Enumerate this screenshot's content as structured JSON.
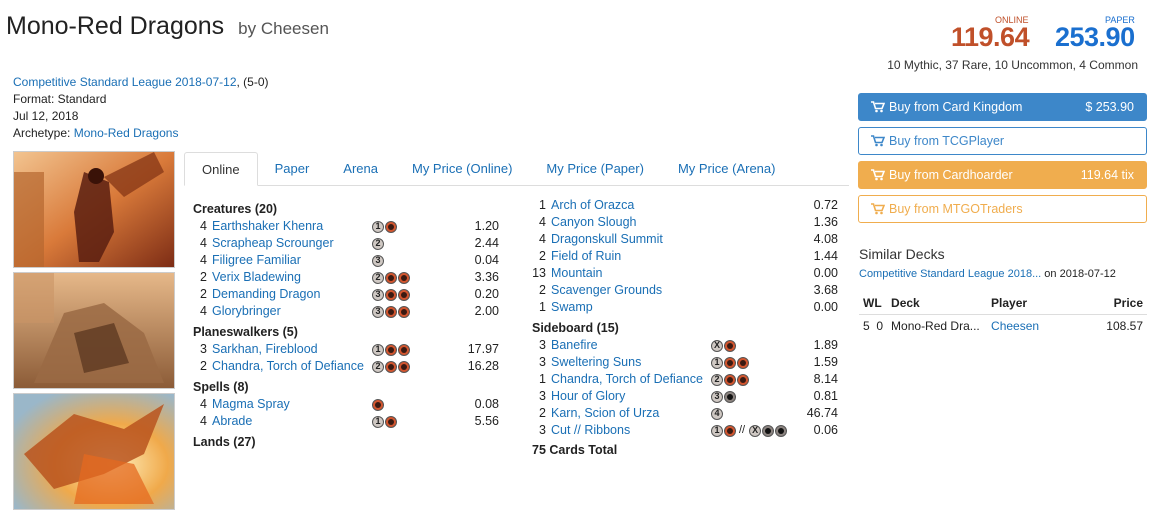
{
  "deck": {
    "title": "Mono-Red Dragons",
    "author": "by Cheesen",
    "event_link": "Competitive Standard League 2018-07-12",
    "record": ", (5-0)",
    "format": "Format: Standard",
    "date": "Jul 12, 2018",
    "archetype_label": "Archetype:",
    "archetype": "Mono-Red Dragons"
  },
  "prices": {
    "online_label": "ONLINE",
    "online_value": "119.64",
    "paper_label": "PAPER",
    "paper_value": "253.90",
    "rarity": "10 Mythic, 37 Rare, 10 Uncommon, 4 Common",
    "online_color": "#c0502a",
    "paper_color": "#1a6fcf"
  },
  "buy": [
    {
      "label": "Buy from Card Kingdom",
      "amount": "$ 253.90",
      "style": "solid",
      "color": "#3d87c9"
    },
    {
      "label": "Buy from TCGPlayer",
      "amount": "",
      "style": "outline",
      "color": "#3d87c9"
    },
    {
      "label": "Buy from Cardhoarder",
      "amount": "119.64 tix",
      "style": "solid",
      "color": "#f0ad4e"
    },
    {
      "label": "Buy from MTGOTraders",
      "amount": "",
      "style": "outline",
      "color": "#f0ad4e"
    }
  ],
  "similar": {
    "heading": "Similar Decks",
    "link": "Competitive Standard League 2018...",
    "link_suffix": " on 2018-07-12",
    "headers": [
      "WL",
      "Deck",
      "Player",
      "Price"
    ],
    "rows": [
      {
        "w": "5",
        "l": "0",
        "deck": "Mono-Red Dra...",
        "player": "Cheesen",
        "price": "108.57"
      }
    ]
  },
  "tabs": [
    "Online",
    "Paper",
    "Arena",
    "My Price (Online)",
    "My Price (Paper)",
    "My Price (Arena)"
  ],
  "left_column": [
    {
      "section": "Creatures (20)",
      "cards": [
        {
          "qty": "4",
          "name": "Earthshaker Khenra",
          "cost": [
            "1",
            "R"
          ],
          "price": "1.20"
        },
        {
          "qty": "4",
          "name": "Scrapheap Scrounger",
          "cost": [
            "2"
          ],
          "price": "2.44"
        },
        {
          "qty": "4",
          "name": "Filigree Familiar",
          "cost": [
            "3"
          ],
          "price": "0.04"
        },
        {
          "qty": "2",
          "name": "Verix Bladewing",
          "cost": [
            "2",
            "R",
            "R"
          ],
          "price": "3.36"
        },
        {
          "qty": "2",
          "name": "Demanding Dragon",
          "cost": [
            "3",
            "R",
            "R"
          ],
          "price": "0.20"
        },
        {
          "qty": "4",
          "name": "Glorybringer",
          "cost": [
            "3",
            "R",
            "R"
          ],
          "price": "2.00"
        }
      ]
    },
    {
      "section": "Planeswalkers (5)",
      "cards": [
        {
          "qty": "3",
          "name": "Sarkhan, Fireblood",
          "cost": [
            "1",
            "R",
            "R"
          ],
          "price": "17.97"
        },
        {
          "qty": "2",
          "name": "Chandra, Torch of Defiance",
          "cost": [
            "2",
            "R",
            "R"
          ],
          "price": "16.28"
        }
      ]
    },
    {
      "section": "Spells (8)",
      "cards": [
        {
          "qty": "4",
          "name": "Magma Spray",
          "cost": [
            "R"
          ],
          "price": "0.08"
        },
        {
          "qty": "4",
          "name": "Abrade",
          "cost": [
            "1",
            "R"
          ],
          "price": "5.56"
        }
      ]
    },
    {
      "section": "Lands (27)",
      "cards": []
    }
  ],
  "lands": [
    {
      "qty": "1",
      "name": "Arch of Orazca",
      "price": "0.72"
    },
    {
      "qty": "4",
      "name": "Canyon Slough",
      "price": "1.36"
    },
    {
      "qty": "4",
      "name": "Dragonskull Summit",
      "price": "4.08"
    },
    {
      "qty": "2",
      "name": "Field of Ruin",
      "price": "1.44"
    },
    {
      "qty": "13",
      "name": "Mountain",
      "price": "0.00"
    },
    {
      "qty": "2",
      "name": "Scavenger Grounds",
      "price": "3.68"
    },
    {
      "qty": "1",
      "name": "Swamp",
      "price": "0.00"
    }
  ],
  "sideboard": {
    "section": "Sideboard (15)",
    "cards": [
      {
        "qty": "3",
        "name": "Banefire",
        "cost": [
          "X",
          "R"
        ],
        "price": "1.89"
      },
      {
        "qty": "3",
        "name": "Sweltering Suns",
        "cost": [
          "1",
          "R",
          "R"
        ],
        "price": "1.59"
      },
      {
        "qty": "1",
        "name": "Chandra, Torch of Defiance",
        "cost": [
          "2",
          "R",
          "R"
        ],
        "price": "8.14"
      },
      {
        "qty": "3",
        "name": "Hour of Glory",
        "cost": [
          "3",
          "B"
        ],
        "price": "0.81"
      },
      {
        "qty": "2",
        "name": "Karn, Scion of Urza",
        "cost": [
          "4"
        ],
        "price": "46.74"
      },
      {
        "qty": "3",
        "name": "Cut // Ribbons",
        "cost": [
          "1",
          "R",
          "//",
          "X",
          "B",
          "B"
        ],
        "price": "0.06"
      }
    ]
  },
  "total": "75 Cards Total"
}
